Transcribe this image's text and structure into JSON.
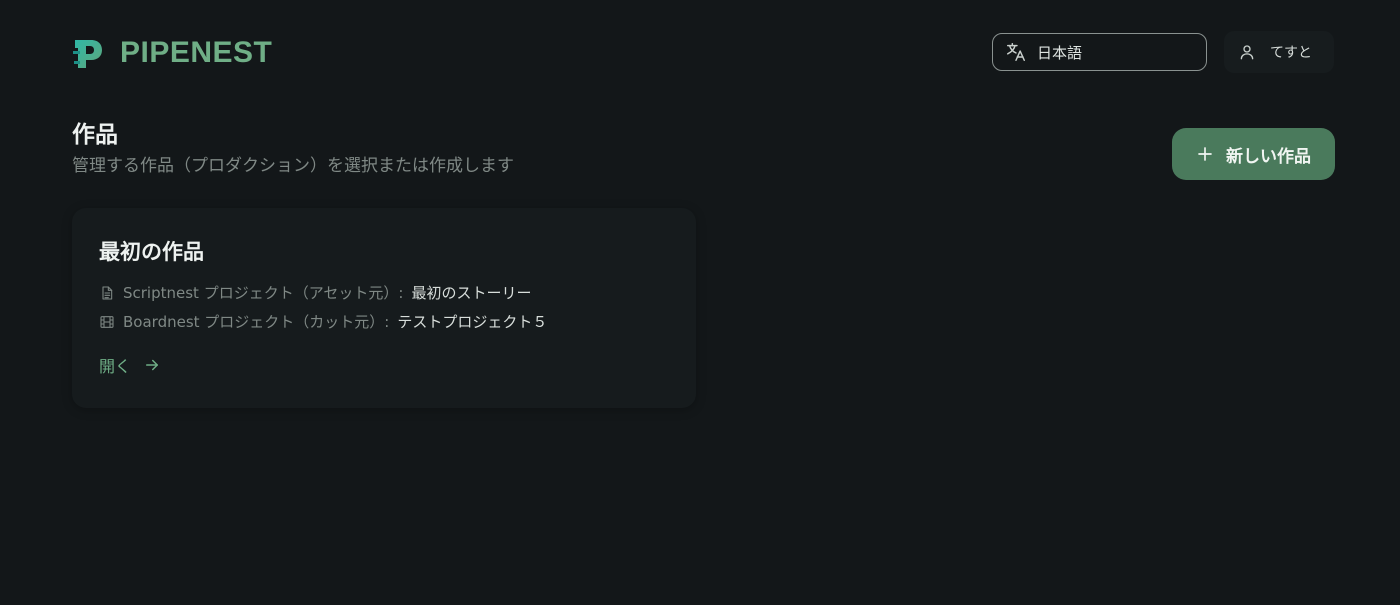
{
  "header": {
    "brand_name": "PIPENEST",
    "language": {
      "selected": "日本語",
      "icon": "translate-icon"
    },
    "user": {
      "name": "てすと",
      "icon": "user-icon"
    }
  },
  "page": {
    "title": "作品",
    "subtitle": "管理する作品（プロダクション）を選択または作成します",
    "new_button_label": "新しい作品"
  },
  "works": [
    {
      "title": "最初の作品",
      "scriptnest_label": "Scriptnest プロジェクト（アセット元）:",
      "scriptnest_value": "最初のストーリー",
      "boardnest_label": "Boardnest プロジェクト（カット元）:",
      "boardnest_value": "テストプロジェクト５",
      "open_label": "開く"
    }
  ],
  "colors": {
    "background": "#131719",
    "accent": "#6fae86",
    "button": "#4a7a5c",
    "card": "#161b1d"
  }
}
